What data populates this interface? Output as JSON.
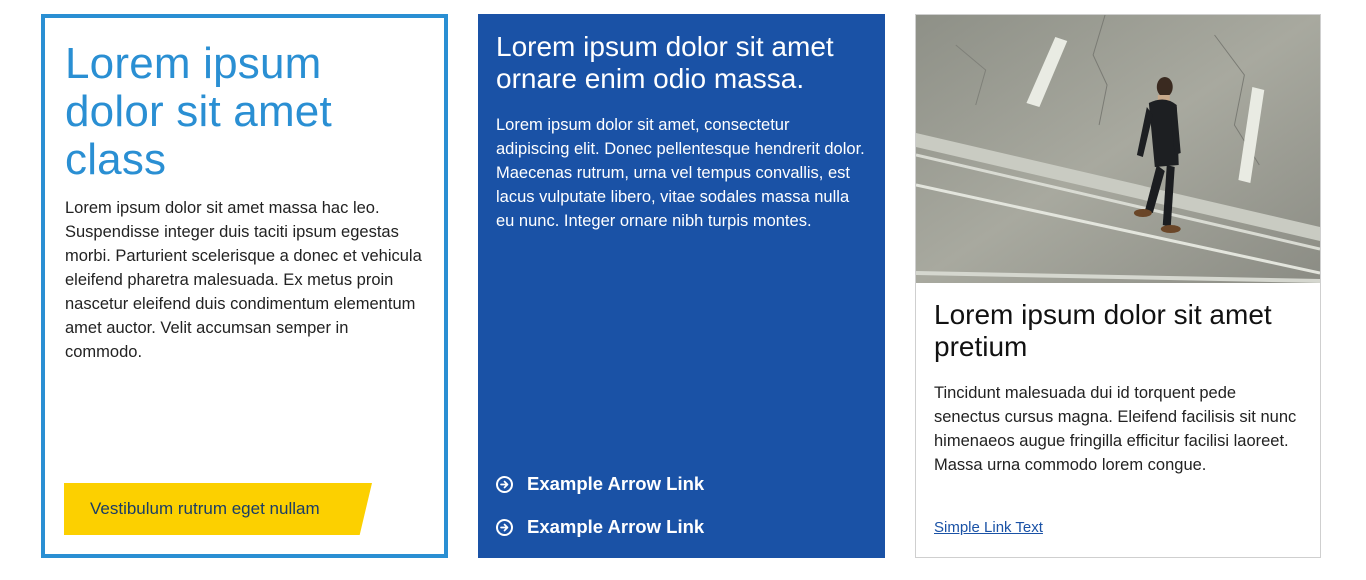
{
  "cards": [
    {
      "title": "Lorem ipsum dolor sit amet class",
      "body": "Lorem ipsum dolor sit amet massa hac leo. Suspendisse integer duis taciti ipsum egestas morbi. Parturient scelerisque a donec et vehicula eleifend pharetra malesuada. Ex metus proin nascetur eleifend duis condimentum elementum amet auctor. Velit accumsan semper in commodo.",
      "cta_label": "Vestibulum rutrum eget nullam"
    },
    {
      "title": "Lorem ipsum dolor sit amet ornare enim odio massa.",
      "body": "Lorem ipsum dolor sit amet, consectetur adipiscing elit. Donec pellentesque hendrerit dolor. Maecenas rutrum, urna vel tempus convallis, est lacus vulputate libero, vitae sodales massa nulla eu nunc. Integer ornare nibh turpis montes.",
      "links": [
        {
          "label": "Example Arrow Link",
          "icon": "arrow-circle-right-icon"
        },
        {
          "label": "Example Arrow Link",
          "icon": "arrow-circle-right-icon"
        }
      ]
    },
    {
      "image": "photo of man in suit walking on street",
      "title": "Lorem ipsum dolor sit amet pretium",
      "body": "Tincidunt malesuada dui id torquent pede senectus cursus magna. Eleifend facilisis sit nunc himenaeos augue fringilla efficitur facilisi laoreet. Massa urna commodo lorem congue.",
      "link_label": "Simple Link Text"
    }
  ],
  "colors": {
    "card1_border": "#2a8fd3",
    "cta_background": "#fcd000",
    "card2_background": "#1a52a6",
    "card3_border": "#cfcfcf"
  }
}
